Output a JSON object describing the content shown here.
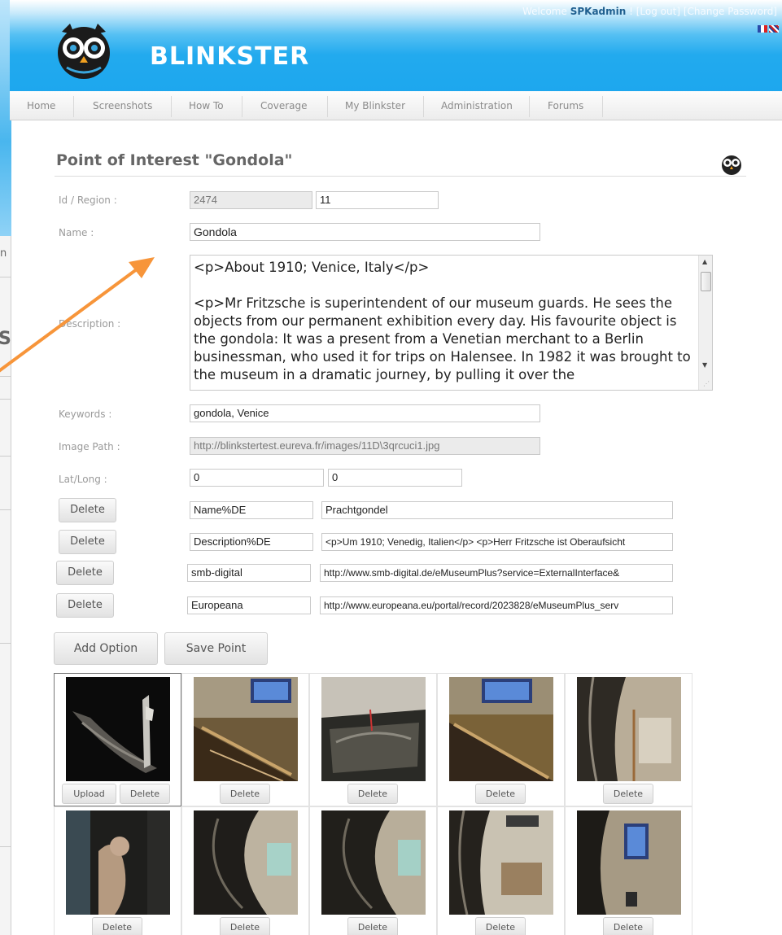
{
  "header": {
    "welcome_prefix": "Welcome",
    "username": "SPKadmin",
    "links": " ! [Log out] [Change Password]",
    "brand": "BLINKSTER"
  },
  "background_window": {
    "text1": "n",
    "text2": "S"
  },
  "nav": [
    "Home",
    "Screenshots",
    "How To",
    "Coverage",
    "My Blinkster",
    "Administration",
    "Forums"
  ],
  "page_title": "Point of Interest \"Gondola\"",
  "labels": {
    "id_region": "Id / Region :",
    "name": "Name :",
    "description": "Description :",
    "keywords": "Keywords :",
    "image_path": "Image Path :",
    "latlong": "Lat/Long :"
  },
  "fields": {
    "id": "2474",
    "region": "11",
    "name": "Gondola",
    "description": "<p>About 1910; Venice, Italy</p>\n\n<p>Mr Fritzsche is superintendent of our museum guards. He sees the objects from our permanent exhibition every day. His favourite object is the gondola: It was a present from a Venetian merchant to a Berlin businessman, who used it for trips on Halensee. In 1982 it was brought to the museum in a dramatic journey, by pulling it over the",
    "keywords": "gondola, Venice",
    "image_path": "http://blinkstertest.eureva.fr/images/11D\\3qrcuci1.jpg",
    "lat": "0",
    "long": "0"
  },
  "options": [
    {
      "delete_label": "Delete",
      "key": "Name%DE",
      "value": "Prachtgondel"
    },
    {
      "delete_label": "Delete",
      "key": "Description%DE",
      "value": "<p>Um 1910; Venedig, Italien</p>  <p>Herr Fritzsche ist Oberaufsicht"
    },
    {
      "delete_label": "Delete",
      "key": "smb-digital",
      "value": "http://www.smb-digital.de/eMuseumPlus?service=ExternalInterface&"
    },
    {
      "delete_label": "Delete",
      "key": "Europeana",
      "value": "http://www.europeana.eu/portal/record/2023828/eMuseumPlus_serv"
    }
  ],
  "buttons": {
    "add_option": "Add Option",
    "save_point": "Save Point"
  },
  "gallery": {
    "upload_label": "Upload",
    "delete_label": "Delete",
    "images": [
      {
        "name": "gondola-photo-1",
        "selected": true
      },
      {
        "name": "gondola-photo-2"
      },
      {
        "name": "gondola-photo-3"
      },
      {
        "name": "gondola-photo-4"
      },
      {
        "name": "gondola-photo-5"
      },
      {
        "name": "gondola-photo-6"
      },
      {
        "name": "gondola-photo-7"
      },
      {
        "name": "gondola-photo-8"
      },
      {
        "name": "gondola-photo-9"
      },
      {
        "name": "gondola-photo-10"
      }
    ]
  },
  "colors": {
    "header_blue": "#1da7ee",
    "arrow": "#f7953a"
  }
}
